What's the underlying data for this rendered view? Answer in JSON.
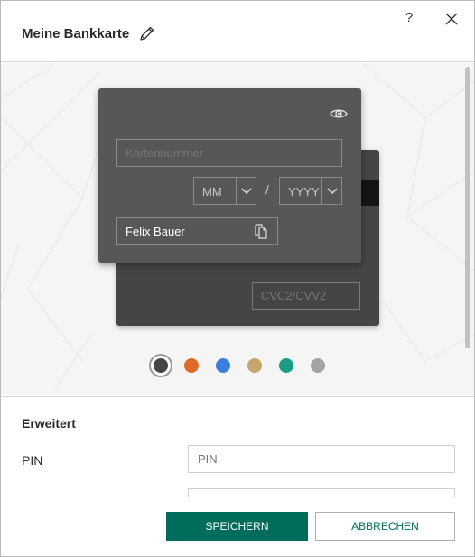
{
  "header": {
    "title": "Meine Bankkarte",
    "help_label": "?"
  },
  "card": {
    "card_number_placeholder": "Kartennummer",
    "month_value": "MM",
    "year_value": "YYYY",
    "date_separator": "/",
    "cardholder_name": "Felix Bauer",
    "cvc_placeholder": "CVC2/CVV2",
    "front_color": "#575757",
    "back_color": "#454545"
  },
  "color_swatches": [
    {
      "color": "#454545",
      "selected": true
    },
    {
      "color": "#e06a28",
      "selected": false
    },
    {
      "color": "#3a7fde",
      "selected": false
    },
    {
      "color": "#c7a46a",
      "selected": false
    },
    {
      "color": "#1b9c86",
      "selected": false
    },
    {
      "color": "#a3a3a3",
      "selected": false
    }
  ],
  "advanced": {
    "title": "Erweitert",
    "pin_label": "PIN",
    "pin_placeholder": "PIN"
  },
  "footer": {
    "save_label": "SPEICHERN",
    "cancel_label": "ABBRECHEN"
  },
  "colors": {
    "accent": "#006d5b"
  }
}
